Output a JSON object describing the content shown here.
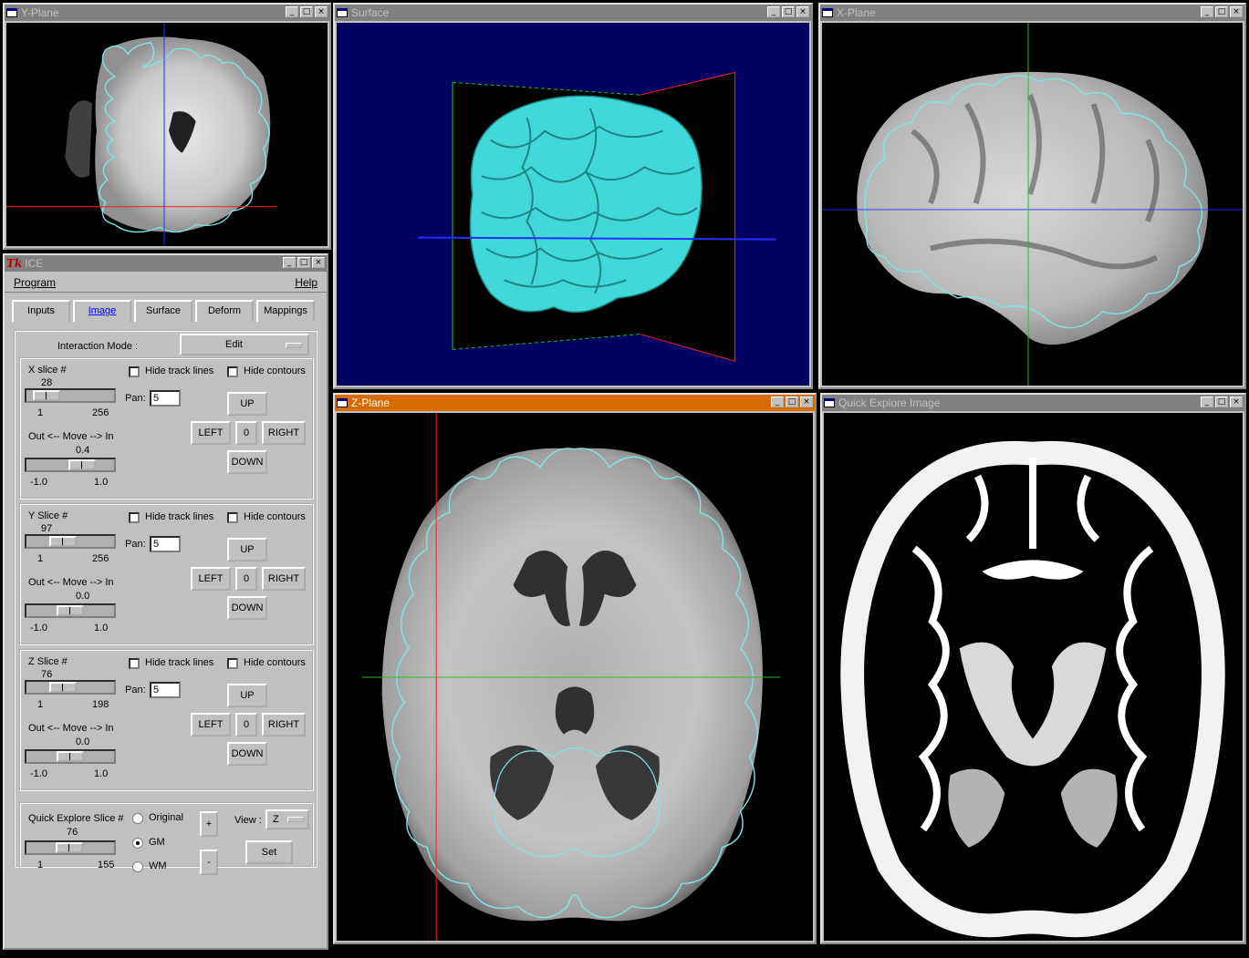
{
  "windows": {
    "yplane": {
      "title": "Y-Plane"
    },
    "surface": {
      "title": "Surface"
    },
    "xplane": {
      "title": "X-Plane"
    },
    "ice": {
      "title": "ICE",
      "tk_glyph": "Tk"
    },
    "zplane": {
      "title": "Z-Plane"
    },
    "quick": {
      "title": "Quick Explore Image"
    }
  },
  "title_buttons": {
    "minimize": "_",
    "maximize": "□",
    "close": "×"
  },
  "menubar": {
    "program": "Program",
    "help": "Help"
  },
  "tabs": [
    {
      "label": "Inputs"
    },
    {
      "label": "Image"
    },
    {
      "label": "Surface"
    },
    {
      "label": "Deform"
    },
    {
      "label": "Mappings"
    }
  ],
  "interaction": {
    "label": "Interaction Mode :",
    "value": "Edit"
  },
  "common": {
    "hide_track": "Hide track lines",
    "hide_contours": "Hide contours",
    "pan_label": "Pan:",
    "up": "UP",
    "down": "DOWN",
    "left": "LEFT",
    "zero": "0",
    "right": "RIGHT",
    "move_label": "Out <-- Move --> In"
  },
  "slices": [
    {
      "label": "X slice #",
      "value": "28",
      "min": "1",
      "max": "256",
      "pan": "5",
      "move": "0.4",
      "move_min": "-1.0",
      "move_max": "1.0",
      "slice_frac": 0.11,
      "move_frac": 0.7
    },
    {
      "label": "Y Slice #",
      "value": "97",
      "min": "1",
      "max": "256",
      "pan": "5",
      "move": "0.0",
      "move_min": "-1.0",
      "move_max": "1.0",
      "slice_frac": 0.38,
      "move_frac": 0.5
    },
    {
      "label": "Z Slice #",
      "value": "76",
      "min": "1",
      "max": "198",
      "pan": "5",
      "move": "0.0",
      "move_min": "-1.0",
      "move_max": "1.0",
      "slice_frac": 0.38,
      "move_frac": 0.5
    }
  ],
  "quick_explore": {
    "label": "Quick Explore Slice #",
    "value": "76",
    "min": "1",
    "max": "155",
    "slice_frac": 0.49,
    "options": [
      "Original",
      "GM",
      "WM"
    ],
    "selected": "GM",
    "plus": "+",
    "minus": "-",
    "view_label": "View :",
    "view_value": "Z",
    "set": "Set"
  },
  "colors": {
    "contour": "#7fe6e6",
    "surface_fill": "#40d8d8",
    "surface_bg": "#000060",
    "zplane_title": "#d86b00",
    "track_red": "#ff2020",
    "track_green": "#20c020",
    "track_blue": "#2030ff"
  }
}
